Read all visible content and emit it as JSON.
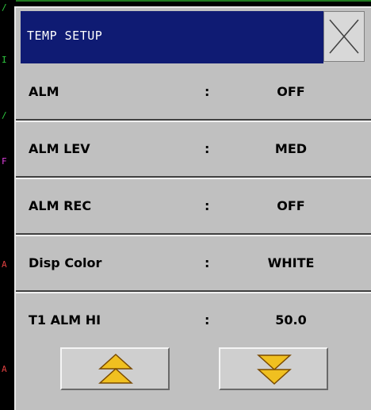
{
  "background": {
    "marks": [
      {
        "text": "/",
        "color": "#2ecc40"
      },
      {
        "text": "I",
        "color": "#2ecc40"
      },
      {
        "text": "/",
        "color": "#2ecc40"
      },
      {
        "text": "F",
        "color": "#e040e0"
      },
      {
        "text": "A",
        "color": "#e04040"
      },
      {
        "text": "A",
        "color": "#e04040"
      }
    ]
  },
  "dialog": {
    "title": "TEMP SETUP",
    "close_icon": "close-x-icon",
    "rows": [
      {
        "label": "ALM",
        "colon": ":",
        "value": "OFF"
      },
      {
        "label": "ALM LEV",
        "colon": ":",
        "value": "MED"
      },
      {
        "label": "ALM REC",
        "colon": ":",
        "value": "OFF"
      },
      {
        "label": "Disp Color",
        "colon": ":",
        "value": "WHITE"
      },
      {
        "label": "T1 ALM HI",
        "colon": ":",
        "value": "50.0"
      }
    ],
    "nav": {
      "page_up_icon": "double-chevron-up-icon",
      "page_down_icon": "double-chevron-down-icon",
      "arrow_fill": "#f0c020",
      "arrow_stroke": "#7a4a00"
    },
    "colors": {
      "title_bg": "#0f1b73",
      "panel_bg": "#c0c0c0"
    }
  }
}
